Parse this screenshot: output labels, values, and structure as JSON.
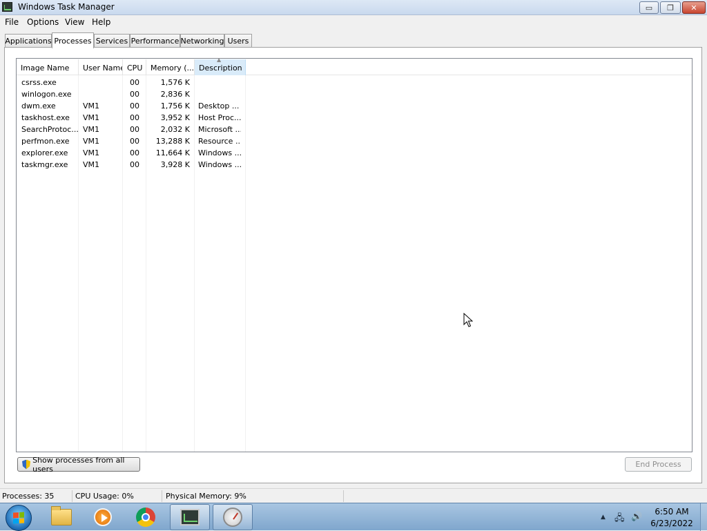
{
  "window": {
    "title": "Windows Task Manager",
    "minimize_glyph": "▭",
    "maximize_glyph": "❐",
    "close_glyph": "✕"
  },
  "menu": [
    "File",
    "Options",
    "View",
    "Help"
  ],
  "tabs": [
    {
      "label": "Applications",
      "active": false
    },
    {
      "label": "Processes",
      "active": true
    },
    {
      "label": "Services",
      "active": false
    },
    {
      "label": "Performance",
      "active": false
    },
    {
      "label": "Networking",
      "active": false
    },
    {
      "label": "Users",
      "active": false
    }
  ],
  "process_table": {
    "columns": [
      "Image Name",
      "User Name",
      "CPU",
      "Memory (...",
      "Description"
    ],
    "sorted_column": "Description",
    "rows": [
      {
        "image": "csrss.exe",
        "user": "",
        "cpu": "00",
        "memory": "1,576 K",
        "description": ""
      },
      {
        "image": "winlogon.exe",
        "user": "",
        "cpu": "00",
        "memory": "2,836 K",
        "description": ""
      },
      {
        "image": "dwm.exe",
        "user": "VM1",
        "cpu": "00",
        "memory": "1,756 K",
        "description": "Desktop ..."
      },
      {
        "image": "taskhost.exe",
        "user": "VM1",
        "cpu": "00",
        "memory": "3,952 K",
        "description": "Host Proc..."
      },
      {
        "image": "SearchProtoc...",
        "user": "VM1",
        "cpu": "00",
        "memory": "2,032 K",
        "description": "Microsoft ..."
      },
      {
        "image": "perfmon.exe",
        "user": "VM1",
        "cpu": "00",
        "memory": "13,288 K",
        "description": "Resource ..."
      },
      {
        "image": "explorer.exe",
        "user": "VM1",
        "cpu": "00",
        "memory": "11,664 K",
        "description": "Windows ..."
      },
      {
        "image": "taskmgr.exe",
        "user": "VM1",
        "cpu": "00",
        "memory": "3,928 K",
        "description": "Windows ..."
      }
    ]
  },
  "buttons": {
    "show_all_processes": "Show processes from all users",
    "end_process": "End Process"
  },
  "status": {
    "processes": "Processes: 35",
    "cpu_usage": "CPU Usage: 0%",
    "physical_memory": "Physical Memory: 9%"
  },
  "taskbar": {
    "apps": [
      "folder-icon",
      "media-player-icon",
      "chrome-icon",
      "taskmgr-icon",
      "perf-icon"
    ],
    "tray_icons": [
      "tray-up-arrow-icon",
      "network-icon",
      "volume-icon"
    ],
    "time": "6:50 AM",
    "date": "6/23/2022"
  }
}
